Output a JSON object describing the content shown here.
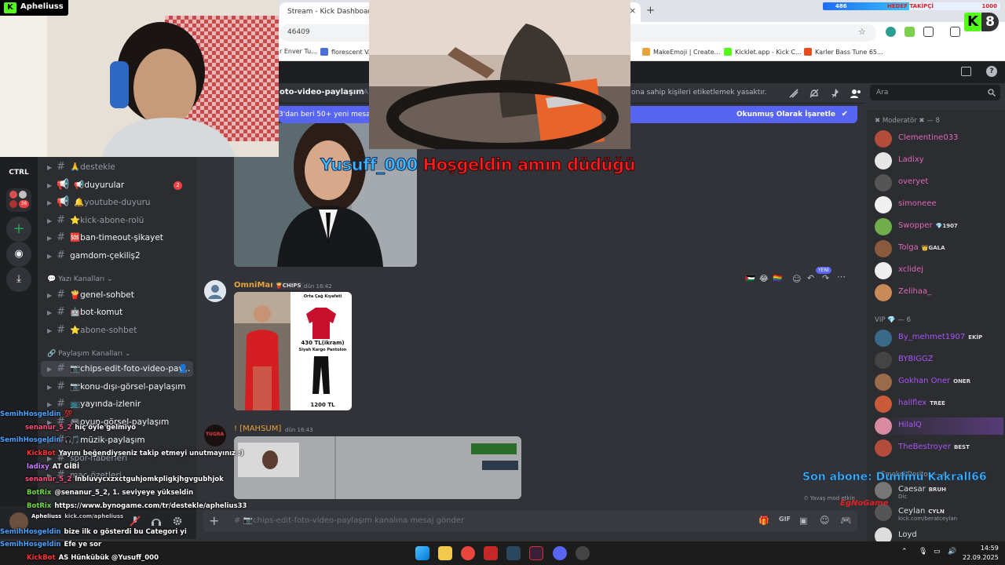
{
  "browser": {
    "tab_title": "Stream - Kick Dashboard",
    "close_glyph": "×",
    "new_tab_glyph": "+",
    "address": "46409",
    "bookmarks": [
      "r Enver Tu...",
      "florescent VA...",
      "MakeEmoji | Create...",
      "Kicklet.app - Kick C...",
      "Karler Bass Tune 65..."
    ]
  },
  "discord": {
    "guild_label": "CTRL",
    "guild_badge": "36",
    "channel_title": "oto-video-paylaşım",
    "channel_header_extra": "SA",
    "channel_topic_tail": "ona sahip kişileri etiketlemek yasaktır.",
    "search_placeholder": "Ara",
    "unread_left": "3'dan beri 50+ yeni mesaj",
    "unread_right": "Okunmuş Olarak İşaretle",
    "categories": {
      "text": "Yazı Kanalları",
      "share": "Paylaşım Kanalları"
    },
    "channels_top": [
      {
        "label": "🙏destekle",
        "bright": false
      },
      {
        "label": "📢duyurular",
        "bright": true,
        "badge": "2"
      },
      {
        "label": "🔔youtube-duyuru",
        "bright": false
      },
      {
        "label": "⭐kick-abone-rolü",
        "bright": false
      },
      {
        "label": "🆘ban-timeout-şikayet",
        "bright": true
      },
      {
        "label": "gamdom-çekiliş2",
        "bright": true
      }
    ],
    "channels_text": [
      {
        "label": "🍟genel-sohbet",
        "bright": true
      },
      {
        "label": "🤖bot-komut",
        "bright": true
      },
      {
        "label": "⭐abone-sohbet",
        "bright": false
      }
    ],
    "channels_share": [
      {
        "label": "📷chips-edit-foto-video-pay...",
        "active": true
      },
      {
        "label": "📷konu-dışı-görsel-paylaşım",
        "bright": true
      },
      {
        "label": "📺yayında-izlenir",
        "bright": true
      },
      {
        "label": "🎮oyun-görsel-paylaşım",
        "bright": true
      },
      {
        "label": "🎵müzik-paylaşım",
        "bright": true
      },
      {
        "label": "spor-haberleri",
        "bright": false
      },
      {
        "label": "maç-özetleri",
        "bright": false
      }
    ],
    "messages": {
      "m1_author": "OmniMan",
      "m1_tag": "CHIPS",
      "m1_time": "dün 16:42",
      "m1_img_caption_title": "Orta Çağ Kıyafeti",
      "m1_img_price1": "430 TL(ikram)",
      "m1_img_pants": "Siyah Kargo Pantolon",
      "m1_img_price2": "1200 TL",
      "m2_author": "! [MAHSUM]",
      "m2_time": "dün 16:43",
      "m2_avatar_text": "TUGRA",
      "new_badge": "YENİ"
    },
    "composer_placeholder": "# 📷chips-edit-foto-video-paylaşım kanalına mesaj gönder",
    "members": {
      "mod_header": "✖ Moderatör ✖ — 8",
      "mods": [
        {
          "name": "Clementine033",
          "color": "#e067b7"
        },
        {
          "name": "Ladixy",
          "color": "#e067b7"
        },
        {
          "name": "overyet",
          "color": "#e067b7"
        },
        {
          "name": "simoneee",
          "color": "#e067b7"
        },
        {
          "name": "Swopper",
          "color": "#e067b7",
          "tag": "💎1907"
        },
        {
          "name": "Tolga",
          "color": "#e067b7",
          "tag": "👑GALA"
        },
        {
          "name": "xclidej",
          "color": "#e067b7"
        },
        {
          "name": "Zelihaa_",
          "color": "#e067b7"
        }
      ],
      "vip_header": "VIP 💎 — 6",
      "vips": [
        {
          "name": "By_mehmet1907",
          "color": "#a855f7",
          "tag": "EKİP"
        },
        {
          "name": "BYBIGGZ",
          "color": "#a855f7"
        },
        {
          "name": "Gokhan Oner",
          "color": "#a855f7",
          "tag": "ONER"
        },
        {
          "name": "hallflex",
          "color": "#a855f7",
          "tag": "TREE"
        },
        {
          "name": "HilalQ",
          "color": "#a855f7"
        },
        {
          "name": "TheBestroyer",
          "color": "#a855f7",
          "tag": "BEST"
        }
      ],
      "other_header": "Emekçi Doritos — 4",
      "others": [
        {
          "name": "Caesar",
          "color": "#dbdee1",
          "tag": "BRUH",
          "sub": "Dic"
        },
        {
          "name": "Ceylan",
          "color": "#dbdee1",
          "tag": "CYLN",
          "sub": "kick.com/beratceylan"
        },
        {
          "name": "Loyd",
          "color": "#dbdee1"
        }
      ]
    }
  },
  "overlay": {
    "caption_logo": "K",
    "caption_name": "Apheliuss",
    "welcome_user": "Yusuff_000",
    "welcome_text": "Hoşgeldin amın düdüğü",
    "goal_current": "486",
    "goal_label": "HEDEF TAKİPÇİ",
    "goal_target": "1000",
    "goal_fraction": 0.486,
    "kick_digit": "8",
    "last_sub": "Son abone: Dunlinu Kakrall66",
    "yavas_mod": "Yavaş mod etkin",
    "watermark": "EgNoGame"
  },
  "stream_chat": [
    {
      "name": "SemihHosgeldin",
      "color": "#4aa3ff",
      "text": "💯"
    },
    {
      "name": "senanur_5_2",
      "color": "#ff4f7a",
      "text": "hiç öyle gelmiyo"
    },
    {
      "name": "SemihHosgeldin",
      "color": "#4aa3ff",
      "text": "🎧"
    },
    {
      "name": "KickBot",
      "color": "#ff3333",
      "text": "Yayını beğendiyseniz takip etmeyi unutmayınız :)"
    },
    {
      "name": "ladixy",
      "color": "#c77dff",
      "text": "AT GİBİ"
    },
    {
      "name": "senanur_5_2",
      "color": "#ff4f7a",
      "text": "lnbluvycxzxctguhjomkpligkjhgvgubhjok"
    },
    {
      "name": "BotRix",
      "color": "#6fdc3f",
      "text": "@senanur_5_2, 1. seviyeye yükseldin"
    },
    {
      "name": "BotRix",
      "color": "#6fdc3f",
      "text": "https://www.bynogame.com/tr/destekle/aphelius33"
    },
    {
      "name": "Apheliuss",
      "color": "#ffffff",
      "text": "kick.com/apheliuss"
    },
    {
      "name": "SemihHosgeldin",
      "color": "#4aa3ff",
      "text": "bize ilk o gösterdi bu Categori yi"
    },
    {
      "name": "SemihHosgeldin",
      "color": "#4aa3ff",
      "text": "Efe ye sor"
    },
    {
      "name": "KickBot",
      "color": "#ff3333",
      "text": "AS Hünkübük @Yusuff_000"
    }
  ],
  "taskbar": {
    "time": "14:59",
    "date": "22.09.2025"
  },
  "colors": {
    "discord_bg": "#313338",
    "sidebar_bg": "#2b2d31",
    "blurple": "#5865f2",
    "kick_green": "#53fc18"
  }
}
